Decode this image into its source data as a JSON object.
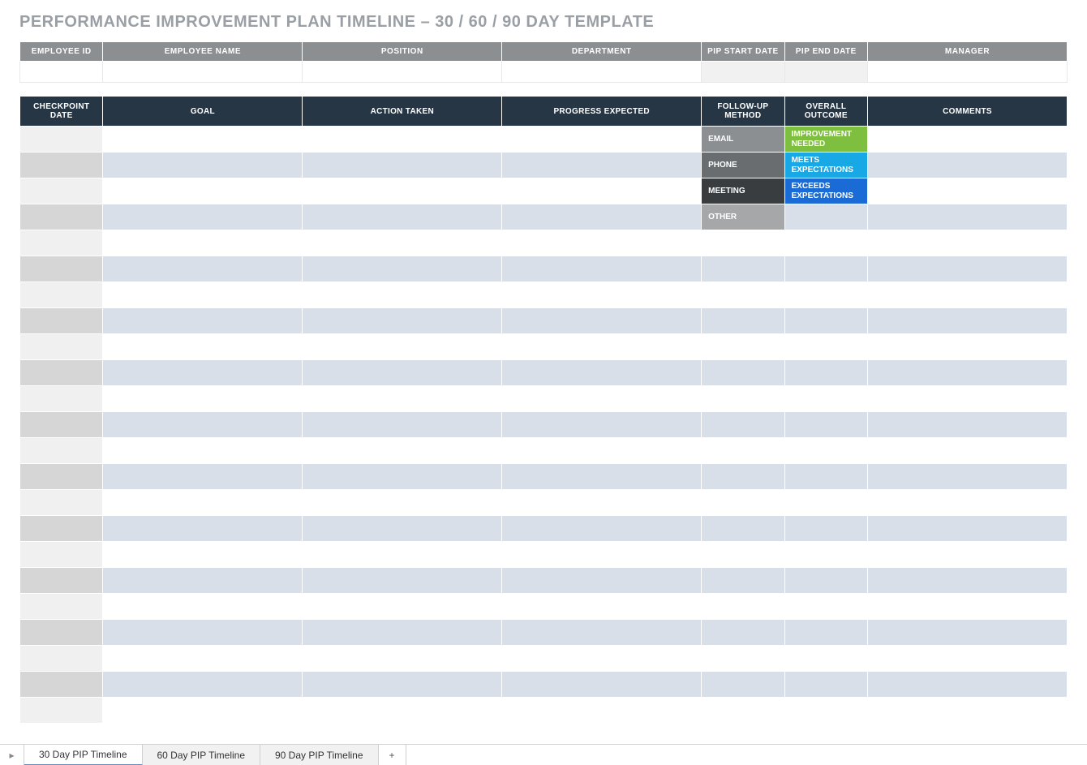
{
  "title": "PERFORMANCE IMPROVEMENT PLAN TIMELINE  –  30 / 60 / 90 DAY TEMPLATE",
  "employee_header": {
    "columns": [
      "EMPLOYEE ID",
      "EMPLOYEE NAME",
      "POSITION",
      "DEPARTMENT",
      "PIP START DATE",
      "PIP END DATE",
      "MANAGER"
    ],
    "values": [
      "",
      "",
      "",
      "",
      "",
      "",
      ""
    ]
  },
  "grid": {
    "columns": [
      "CHECKPOINT DATE",
      "GOAL",
      "ACTION TAKEN",
      "PROGRESS EXPECTED",
      "FOLLOW-UP METHOD",
      "OVERALL OUTCOME",
      "COMMENTS"
    ],
    "followup_legend": [
      "EMAIL",
      "PHONE",
      "MEETING",
      "OTHER"
    ],
    "outcome_legend": [
      "IMPROVEMENT NEEDED",
      "MEETS EXPECTATIONS",
      "EXCEEDS EXPECTATIONS"
    ],
    "row_count": 23
  },
  "tabs": {
    "items": [
      "30 Day PIP Timeline",
      "60 Day PIP Timeline",
      "90 Day PIP Timeline"
    ],
    "active_index": 0
  }
}
